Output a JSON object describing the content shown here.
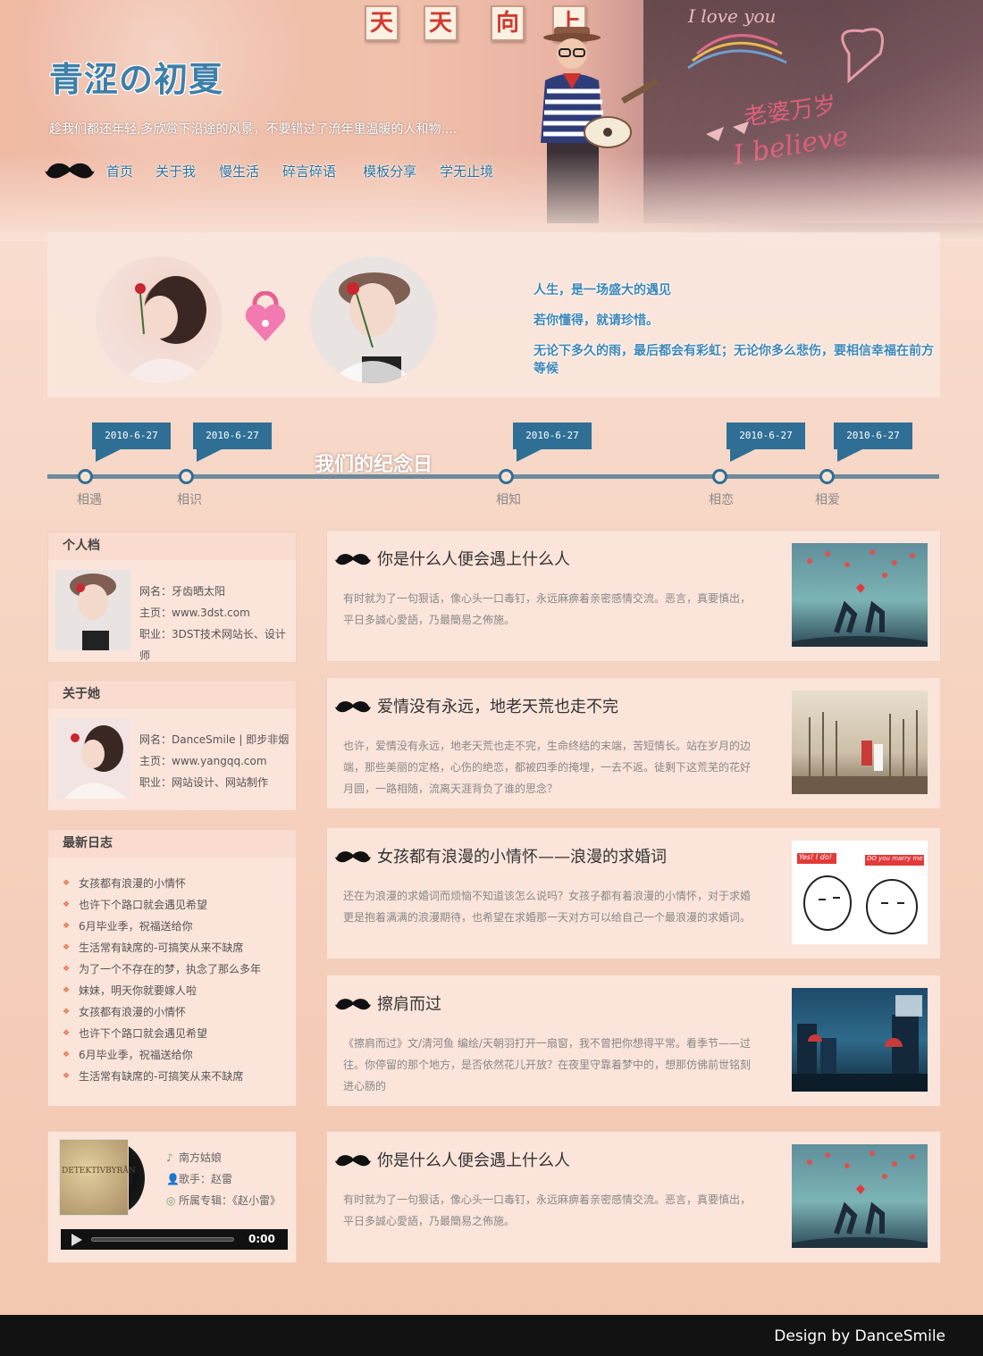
{
  "header": {
    "title": "青涩の初夏",
    "subtitle": "趁我们都还年轻,多欣赏下沿途的风景，不要错过了流年里温暖的人和物....",
    "signs": [
      "天",
      "天",
      "向",
      "上"
    ],
    "chalk": [
      "I love you",
      "老婆万岁",
      "I believe"
    ],
    "nav": [
      "首页",
      "关于我",
      "慢生活",
      "碎言碎语",
      "模板分享",
      "学无止境"
    ]
  },
  "love": {
    "quotes": [
      "人生，是一场盛大的遇见",
      "若你懂得，就请珍惜。",
      "无论下多久的雨，最后都会有彩虹；无论你多么悲伤，要相信幸福在前方等候"
    ]
  },
  "timeline": {
    "title": "我们的纪念日",
    "events": [
      {
        "date": "2010-6-27",
        "label": "相遇"
      },
      {
        "date": "2010-6-27",
        "label": "相识"
      },
      {
        "date": "2010-6-27",
        "label": "相知"
      },
      {
        "date": "2010-6-27",
        "label": "相恋"
      },
      {
        "date": "2010-6-27",
        "label": "相爱"
      }
    ]
  },
  "sidebar": {
    "me": {
      "heading": "个人档",
      "name": "网名：牙齿晒太阳",
      "home": "主页：www.3dst.com",
      "job": "职业：3DST技术网站长、设计师"
    },
    "her": {
      "heading": "关于她",
      "name": "网名：DanceSmile | 即步非烟",
      "home": "主页：www.yangqq.com",
      "job": "职业：网站设计、网站制作"
    },
    "logs": {
      "heading": "最新日志",
      "items": [
        "女孩都有浪漫的小情怀",
        "也许下个路口就会遇见希望",
        "6月毕业季，祝福送给你",
        "生活常有缺席的-可搞笑从来不缺席",
        "为了一个不存在的梦，执念了那么多年",
        "妹妹，明天你就要嫁人啦",
        "女孩都有浪漫的小情怀",
        "也许下个路口就会遇见希望",
        "6月毕业季，祝福送给你",
        "生活常有缺席的-可搞笑从来不缺席"
      ]
    },
    "player": {
      "album_art_text": "DETEKTIVBYRÅN",
      "song": "南方姑娘",
      "singer": "歌手：赵雷",
      "album": "所属专辑：《赵小雷》",
      "time": "0:00"
    }
  },
  "articles": [
    {
      "title": "你是什么人便会遇上什么人",
      "body": "有时就为了一句狠话，像心头一口毒钉，永远麻痹着亲密感情交流。恶言，真要慎出，平日多誠心愛語，乃最簡易之佈施。"
    },
    {
      "title": "爱情没有永远，地老天荒也走不完",
      "body": "也许，爱情没有永远，地老天荒也走不完，生命终结的末端，苦短情长。站在岁月的边端，那些美丽的定格，心伤的绝恋，都被四季的掩埋，一去不返。徒剩下这荒芜的花好月圆，一路相随，流离天涯背负了谁的思念？"
    },
    {
      "title": "女孩都有浪漫的小情怀——浪漫的求婚词",
      "body": "还在为浪漫的求婚词而烦恼不知道该怎么说吗？女孩子都有着浪漫的小情怀，对于求婚更是抱着满满的浪漫期待，也希望在求婚那一天对方可以给自己一个最浪漫的求婚词。"
    },
    {
      "title": "擦肩而过",
      "body": "《擦肩而过》文/清河鱼 编绘/天朝羽打开一扇窗，我不曾把你想得平常。看季节——过往。你停留的那个地方，是否依然花儿开放？在夜里守靠着梦中的，想那仿佛前世铭刻进心肠的"
    },
    {
      "title": "你是什么人便会遇上什么人",
      "body": "有时就为了一句狠话，像心头一口毒钉，永远麻痹着亲密感情交流。恶言，真要慎出，平日多誠心愛語，乃最簡易之佈施。"
    }
  ],
  "thumbs": {
    "yes_i_do": "Yes! I do!",
    "marry_me": "DO you marry me?"
  },
  "footer": {
    "credit": "Design by DanceSmile"
  }
}
